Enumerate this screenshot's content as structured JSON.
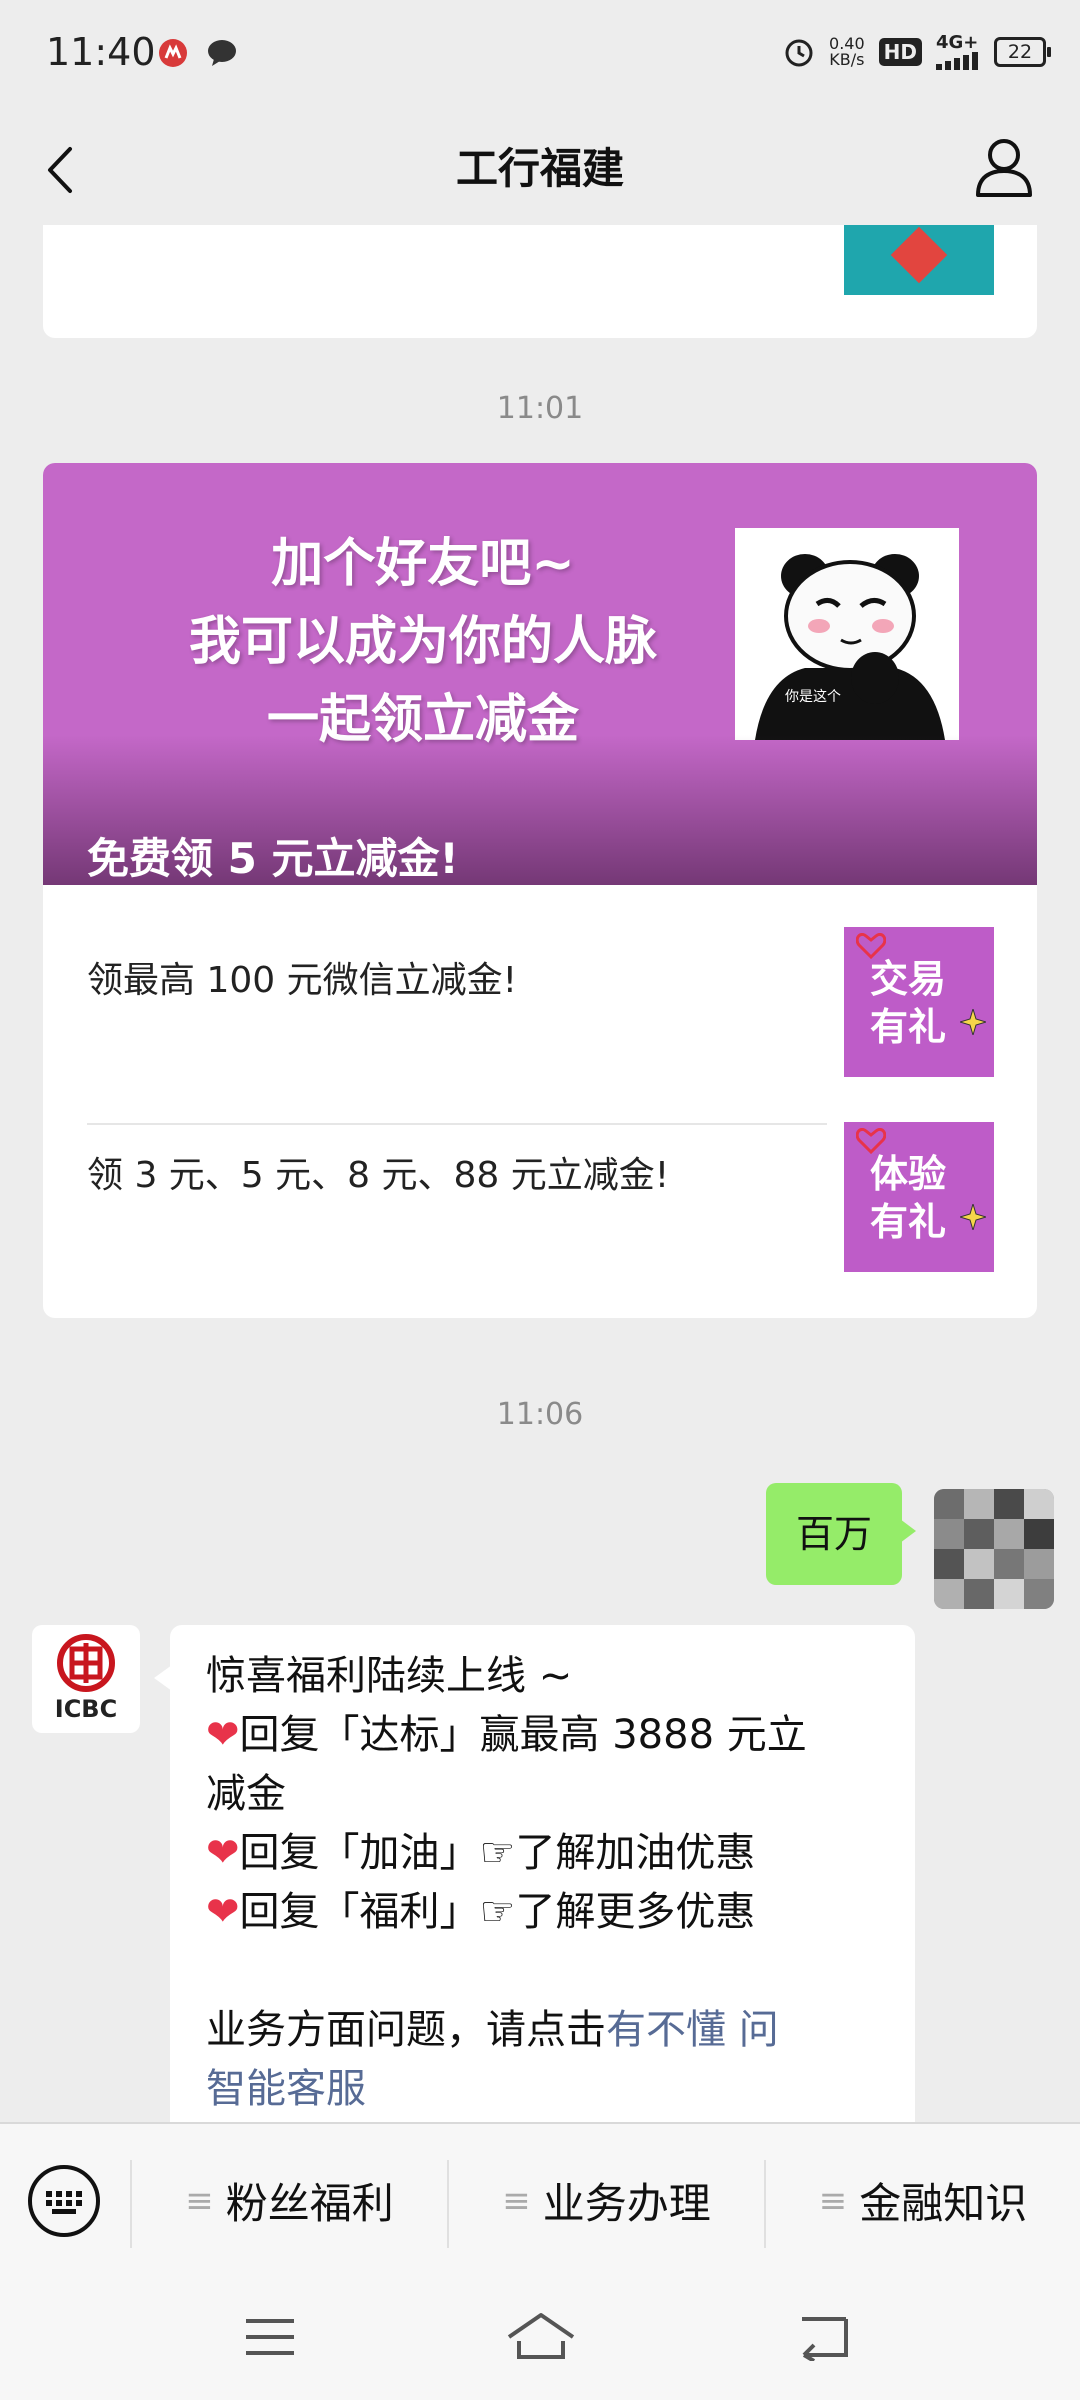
{
  "status_bar": {
    "time": "11:40",
    "net_speed_value": "0.40",
    "net_speed_unit": "KB/s",
    "hd_badge": "HD",
    "network": "4G+",
    "battery": "22"
  },
  "header": {
    "title": "工行福建"
  },
  "timestamps": {
    "first": "11:01",
    "second": "11:06"
  },
  "news_card": {
    "banner_lines": [
      "加个好友吧~",
      "我可以成为你的人脉",
      "一起领立减金"
    ],
    "sticker_caption": "你是这个",
    "banner_caption": "免费领 5 元立减金!",
    "items": [
      {
        "text": "领最高 100 元微信立减金!",
        "thumb_lines": [
          "交易",
          "有礼"
        ]
      },
      {
        "text": "领 3 元、5 元、8 元、88 元立减金!",
        "thumb_lines": [
          "体验",
          "有礼"
        ]
      }
    ]
  },
  "outgoing_message": {
    "text": "百万"
  },
  "incoming_message": {
    "avatar_label": "ICBC",
    "heart_glyph": "❤",
    "point_glyph": "☞",
    "line1": "惊喜福利陆续上线 ~",
    "reply1_a": "回复「达标」赢最高 3888 元立",
    "reply1_b": "减金",
    "reply2_pre": "回复「加油」",
    "reply2_post": "了解加油优惠",
    "reply3_pre": "回复「福利」",
    "reply3_post": "了解更多优惠",
    "service_pre": "业务方面问题，请点击",
    "service_link_a": "有不懂 问",
    "service_link_b": "智能客服"
  },
  "bottom_menu": {
    "items": [
      "粉丝福利",
      "业务办理",
      "金融知识"
    ]
  },
  "colors": {
    "background": "#ededed",
    "outgoing_bubble": "#95ec69",
    "link": "#576b95",
    "banner": "#c468c8",
    "heart": "#e8334a"
  }
}
